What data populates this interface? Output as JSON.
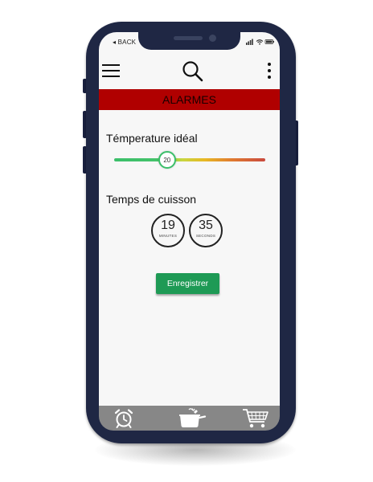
{
  "status_bar": {
    "back_label": "◂ BACK"
  },
  "header": {
    "menu_icon": "hamburger-menu-icon",
    "search_icon": "search-icon",
    "more_icon": "kebab-menu-icon"
  },
  "banner": {
    "title": "ALARMES",
    "color": "#b00000"
  },
  "temperature": {
    "label": "Témperature idéal",
    "value": "20",
    "fraction": 0.35
  },
  "cooking_time": {
    "label": "Temps de cuisson",
    "minutes": "19",
    "minutes_unit": "MINUTES",
    "seconds": "35",
    "seconds_unit": "SECONDS"
  },
  "actions": {
    "save_label": "Enregistrer",
    "save_color": "#1e9a55"
  },
  "bottom_nav": {
    "items": [
      {
        "icon": "alarm-clock-icon"
      },
      {
        "icon": "cooking-pot-icon"
      },
      {
        "icon": "shopping-cart-icon"
      }
    ]
  }
}
